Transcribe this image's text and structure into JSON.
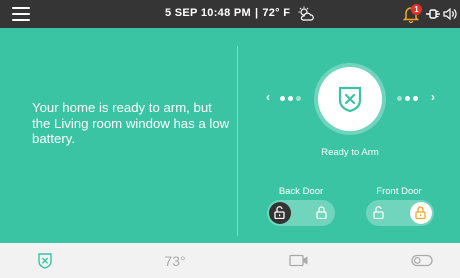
{
  "topbar": {
    "date": "5 SEP",
    "time": "10:48 PM",
    "separator": "|",
    "temperature": "72° F",
    "notifications_count": "1",
    "icons": [
      "menu-icon",
      "partly-cloudy-icon",
      "bell-icon",
      "plug-icon",
      "speaker-icon"
    ]
  },
  "main": {
    "message": "Your home is ready to arm, but the Living room window has a low battery.",
    "arm_status": "Ready to Arm",
    "carousel": {
      "prev_glyph": "‹",
      "next_glyph": "›",
      "active_index": 0
    },
    "doors": [
      {
        "label": "Back Door",
        "state": "unlocked"
      },
      {
        "label": "Front Door",
        "state": "locked"
      }
    ]
  },
  "bottombar": {
    "temperature": "73°",
    "items": [
      "security-shield-icon",
      "thermostat",
      "camera-icon",
      "switch-toggle-icon"
    ]
  },
  "colors": {
    "topbar_bg": "#353535",
    "main_bg": "#3bc4a3",
    "accent": "#3bc4a3",
    "alert_red": "#e0322b",
    "lock_orange": "#f5a623",
    "knob_dark": "#333333"
  }
}
